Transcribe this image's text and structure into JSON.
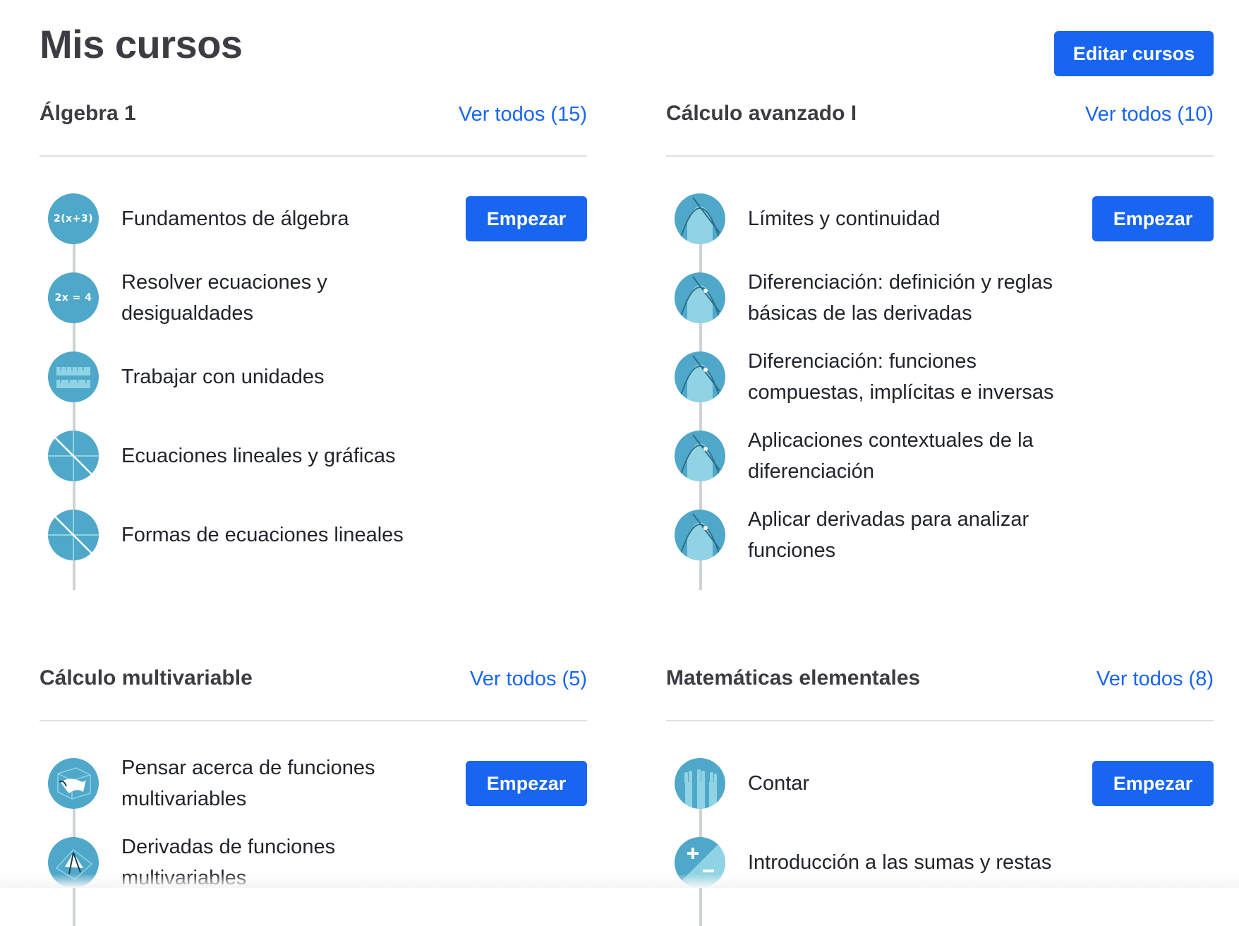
{
  "page": {
    "title": "Mis cursos",
    "edit_label": "Editar cursos"
  },
  "courses": [
    {
      "title": "Álgebra 1",
      "see_all": "Ver todos (15)",
      "start_label": "Empezar",
      "units": [
        {
          "title": "Fundamentos de álgebra",
          "icon": "algebra-expression-icon",
          "icon_text": "2(x+3)"
        },
        {
          "title": "Resolver ecuaciones y desigualdades",
          "icon": "equation-icon",
          "icon_text": "2x = 4"
        },
        {
          "title": "Trabajar con unidades",
          "icon": "ruler-icon",
          "icon_text": ""
        },
        {
          "title": "Ecuaciones lineales y gráficas",
          "icon": "line-graph-icon",
          "icon_text": ""
        },
        {
          "title": "Formas de ecuaciones lineales",
          "icon": "line-graph-icon",
          "icon_text": ""
        }
      ]
    },
    {
      "title": "Cálculo avanzado I",
      "see_all": "Ver todos (10)",
      "start_label": "Empezar",
      "units": [
        {
          "title": "Límites y continuidad",
          "icon": "curve-area-icon"
        },
        {
          "title": "Diferenciación: definición y reglas básicas de las derivadas",
          "icon": "curve-area-icon"
        },
        {
          "title": "Diferenciación: funciones compuestas, implícitas e inversas",
          "icon": "curve-area-icon"
        },
        {
          "title": "Aplicaciones contextuales de la diferenciación",
          "icon": "curve-area-icon"
        },
        {
          "title": "Aplicar derivadas para analizar funciones",
          "icon": "curve-area-icon"
        }
      ]
    },
    {
      "title": "Cálculo multivariable",
      "see_all": "Ver todos (5)",
      "start_label": "Empezar",
      "units": [
        {
          "title": "Pensar acerca de funciones multivariables",
          "icon": "surface-3d-icon"
        },
        {
          "title": "Derivadas de funciones multivariables",
          "icon": "vector-field-icon"
        }
      ]
    },
    {
      "title": "Matemáticas elementales",
      "see_all": "Ver todos (8)",
      "start_label": "Empezar",
      "units": [
        {
          "title": "Contar",
          "icon": "counting-hands-icon"
        },
        {
          "title": "Introducción a las sumas y restas",
          "icon": "plus-minus-icon"
        }
      ]
    }
  ],
  "colors": {
    "accent": "#1865f2",
    "icon_bg": "#4fa8c9",
    "divider": "#dfe0e2"
  }
}
